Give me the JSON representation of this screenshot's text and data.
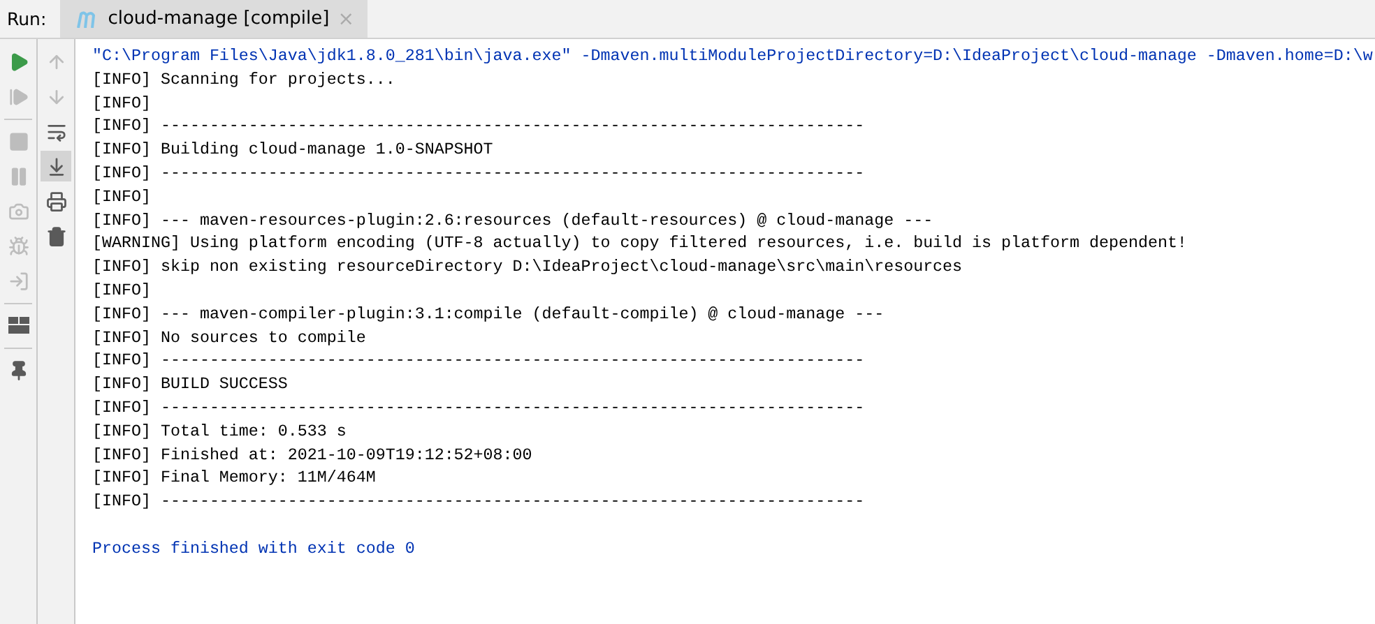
{
  "header": {
    "label": "Run:",
    "tab": {
      "title": "cloud-manage [compile]",
      "selected": true,
      "close": "×"
    }
  },
  "left_tools": [
    {
      "kind": "run",
      "disabled": false
    },
    {
      "kind": "rerun",
      "disabled": true
    },
    {
      "kind": "divider"
    },
    {
      "kind": "stop",
      "disabled": true
    },
    {
      "kind": "pause",
      "disabled": true
    },
    {
      "kind": "camera",
      "disabled": true
    },
    {
      "kind": "debug",
      "disabled": true
    },
    {
      "kind": "exit",
      "disabled": true
    },
    {
      "kind": "divider"
    },
    {
      "kind": "layout",
      "disabled": false
    },
    {
      "kind": "divider"
    },
    {
      "kind": "pin",
      "disabled": false
    }
  ],
  "right_tools": [
    {
      "kind": "up",
      "disabled": true,
      "selected": false
    },
    {
      "kind": "down",
      "disabled": true,
      "selected": false
    },
    {
      "kind": "wrap",
      "disabled": false,
      "selected": false
    },
    {
      "kind": "scroll-end",
      "disabled": false,
      "selected": true
    },
    {
      "kind": "print",
      "disabled": false,
      "selected": false
    },
    {
      "kind": "trash",
      "disabled": false,
      "selected": false
    }
  ],
  "console": [
    {
      "kind": "command",
      "text": "\"C:\\Program Files\\Java\\jdk1.8.0_281\\bin\\java.exe\" -Dmaven.multiModuleProjectDirectory=D:\\IdeaProject\\cloud-manage -Dmaven.home=D:\\w"
    },
    {
      "kind": "log",
      "text": "[INFO] Scanning for projects..."
    },
    {
      "kind": "log",
      "text": "[INFO]"
    },
    {
      "kind": "log",
      "text": "[INFO] ------------------------------------------------------------------------"
    },
    {
      "kind": "log",
      "text": "[INFO] Building cloud-manage 1.0-SNAPSHOT"
    },
    {
      "kind": "log",
      "text": "[INFO] ------------------------------------------------------------------------"
    },
    {
      "kind": "log",
      "text": "[INFO]"
    },
    {
      "kind": "log",
      "text": "[INFO] --- maven-resources-plugin:2.6:resources (default-resources) @ cloud-manage ---"
    },
    {
      "kind": "log",
      "text": "[WARNING] Using platform encoding (UTF-8 actually) to copy filtered resources, i.e. build is platform dependent!"
    },
    {
      "kind": "log",
      "text": "[INFO] skip non existing resourceDirectory D:\\IdeaProject\\cloud-manage\\src\\main\\resources"
    },
    {
      "kind": "log",
      "text": "[INFO]"
    },
    {
      "kind": "log",
      "text": "[INFO] --- maven-compiler-plugin:3.1:compile (default-compile) @ cloud-manage ---"
    },
    {
      "kind": "log",
      "text": "[INFO] No sources to compile"
    },
    {
      "kind": "log",
      "text": "[INFO] ------------------------------------------------------------------------"
    },
    {
      "kind": "log",
      "text": "[INFO] BUILD SUCCESS"
    },
    {
      "kind": "log",
      "text": "[INFO] ------------------------------------------------------------------------"
    },
    {
      "kind": "log",
      "text": "[INFO] Total time: 0.533 s"
    },
    {
      "kind": "log",
      "text": "[INFO] Finished at: 2021-10-09T19:12:52+08:00"
    },
    {
      "kind": "log",
      "text": "[INFO] Final Memory: 11M/464M"
    },
    {
      "kind": "log",
      "text": "[INFO] ------------------------------------------------------------------------"
    },
    {
      "kind": "exit",
      "text": "Process finished with exit code 0"
    }
  ]
}
